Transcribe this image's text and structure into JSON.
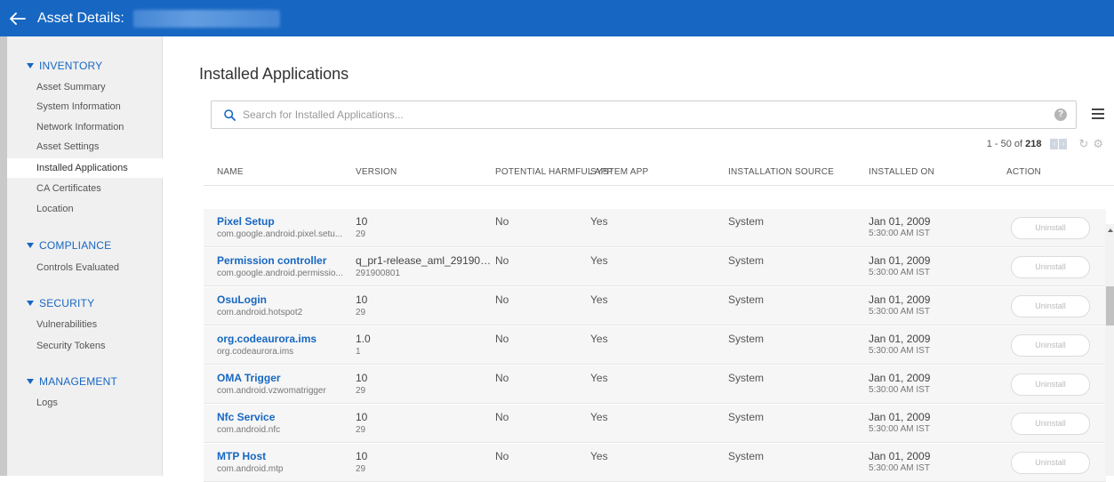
{
  "header": {
    "title": "Asset Details:"
  },
  "sidebar": {
    "sections": [
      {
        "label": "INVENTORY",
        "items": [
          "Asset Summary",
          "System Information",
          "Network Information",
          "Asset Settings",
          "Installed Applications",
          "CA Certificates",
          "Location"
        ]
      },
      {
        "label": "COMPLIANCE",
        "items": [
          "Controls Evaluated"
        ]
      },
      {
        "label": "SECURITY",
        "items": [
          "Vulnerabilities",
          "Security Tokens"
        ]
      },
      {
        "label": "MANAGEMENT",
        "items": [
          "Logs"
        ]
      }
    ],
    "active_item": "Installed Applications"
  },
  "main": {
    "title": "Installed Applications",
    "search": {
      "placeholder": "Search for Installed Applications...",
      "value": ""
    },
    "pager": {
      "range": "1 - 50 of",
      "total": "218"
    },
    "columns": [
      "NAME",
      "VERSION",
      "POTENTIAL HARMFUL APP",
      "SYSTEM APP",
      "INSTALLATION SOURCE",
      "INSTALLED ON",
      "ACTION"
    ],
    "rows": [
      {
        "name": "Pixel Setup",
        "pkg": "com.google.android.pixel.setu...",
        "ver": "10",
        "ver_code": "29",
        "harmful": "No",
        "system": "Yes",
        "source": "System",
        "date": "Jan 01, 2009",
        "time": "5:30:00 AM IST",
        "action": "Uninstall"
      },
      {
        "name": "Permission controller",
        "pkg": "com.google.android.permissio...",
        "ver": "q_pr1-release_aml_291900...",
        "ver_code": "291900801",
        "harmful": "No",
        "system": "Yes",
        "source": "System",
        "date": "Jan 01, 2009",
        "time": "5:30:00 AM IST",
        "action": "Uninstall"
      },
      {
        "name": "OsuLogin",
        "pkg": "com.android.hotspot2",
        "ver": "10",
        "ver_code": "29",
        "harmful": "No",
        "system": "Yes",
        "source": "System",
        "date": "Jan 01, 2009",
        "time": "5:30:00 AM IST",
        "action": "Uninstall"
      },
      {
        "name": "org.codeaurora.ims",
        "pkg": "org.codeaurora.ims",
        "ver": "1.0",
        "ver_code": "1",
        "harmful": "No",
        "system": "Yes",
        "source": "System",
        "date": "Jan 01, 2009",
        "time": "5:30:00 AM IST",
        "action": "Uninstall"
      },
      {
        "name": "OMA Trigger",
        "pkg": "com.android.vzwomatrigger",
        "ver": "10",
        "ver_code": "29",
        "harmful": "No",
        "system": "Yes",
        "source": "System",
        "date": "Jan 01, 2009",
        "time": "5:30:00 AM IST",
        "action": "Uninstall"
      },
      {
        "name": "Nfc Service",
        "pkg": "com.android.nfc",
        "ver": "10",
        "ver_code": "29",
        "harmful": "No",
        "system": "Yes",
        "source": "System",
        "date": "Jan 01, 2009",
        "time": "5:30:00 AM IST",
        "action": "Uninstall"
      },
      {
        "name": "MTP Host",
        "pkg": "com.android.mtp",
        "ver": "10",
        "ver_code": "29",
        "harmful": "No",
        "system": "Yes",
        "source": "System",
        "date": "Jan 01, 2009",
        "time": "5:30:00 AM IST",
        "action": "Uninstall"
      }
    ]
  },
  "colors": {
    "brand": "#1767c2",
    "sidebar_bg": "#f0f0f0"
  },
  "icons": [
    "back-arrow-icon",
    "search-icon",
    "help-icon",
    "menu-icon",
    "refresh-icon",
    "gear-icon"
  ]
}
